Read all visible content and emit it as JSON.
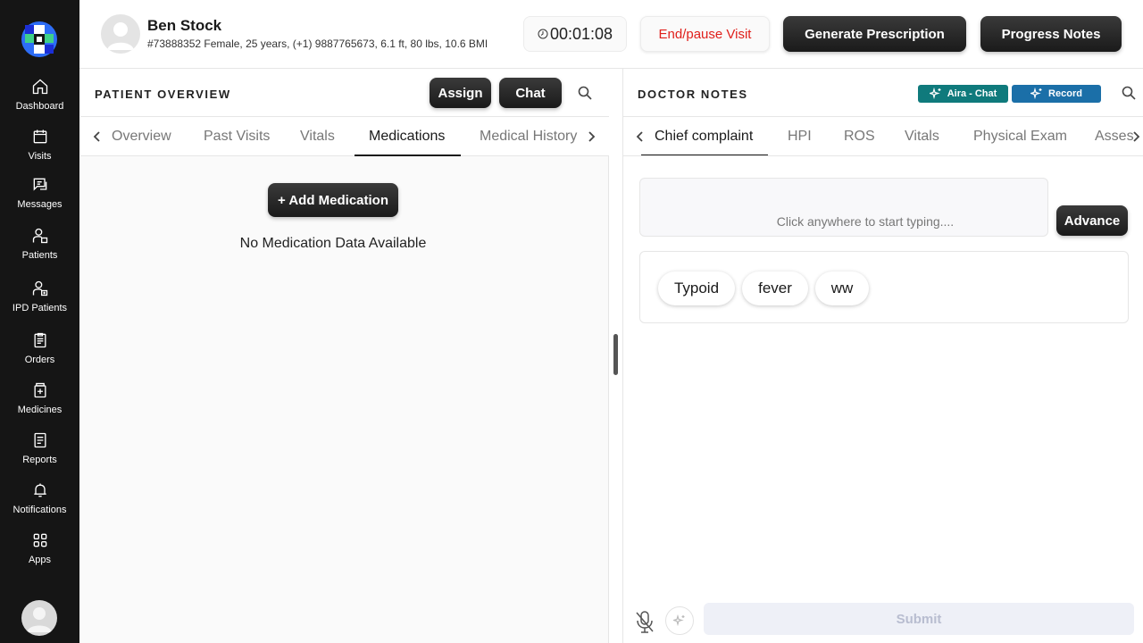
{
  "sidebar": {
    "items": [
      {
        "label": "Dashboard",
        "icon": "home-icon"
      },
      {
        "label": "Visits",
        "icon": "calendar-icon"
      },
      {
        "label": "Messages",
        "icon": "message-icon"
      },
      {
        "label": "Patients",
        "icon": "patient-icon"
      },
      {
        "label": "IPD Patients",
        "icon": "ipd-patient-icon"
      },
      {
        "label": "Orders",
        "icon": "clipboard-icon"
      },
      {
        "label": "Medicines",
        "icon": "medicine-icon"
      },
      {
        "label": "Reports",
        "icon": "report-icon"
      },
      {
        "label": "Notifications",
        "icon": "bell-icon"
      },
      {
        "label": "Apps",
        "icon": "apps-grid-icon"
      }
    ]
  },
  "header": {
    "patient_name": "Ben Stock",
    "patient_meta": "#73888352 Female, 25 years, (+1) 9887765673, 6.1 ft, 80 lbs, 10.6 BMI",
    "timer": "00:01:08",
    "end_visit_label": "End/pause Visit",
    "generate_prescription_label": "Generate Prescription",
    "progress_notes_label": "Progress Notes"
  },
  "left_panel": {
    "title": "PATIENT OVERVIEW",
    "assign_label": "Assign",
    "chat_label": "Chat",
    "tabs": [
      "Overview",
      "Past Visits",
      "Vitals",
      "Medications",
      "Medical History"
    ],
    "active_tab": "Medications",
    "add_medication_label": "+ Add Medication",
    "empty_message": "No Medication Data Available"
  },
  "right_panel": {
    "title": "DOCTOR NOTES",
    "aira_chat_label": "Aira - Chat",
    "record_label": "Record",
    "tabs": [
      "Chief complaint",
      "HPI",
      "ROS",
      "Vitals",
      "Physical Exam",
      "Assess"
    ],
    "active_tab": "Chief complaint",
    "input_placeholder": "Click anywhere to start typing....",
    "advance_label": "Advance",
    "chips": [
      "Typoid",
      "fever",
      "ww"
    ],
    "submit_label": "Submit"
  },
  "colors": {
    "sidebar_bg": "#151515",
    "danger": "#e0201c",
    "aira_teal": "#0f7a7c",
    "record_blue": "#1b6fa8"
  }
}
